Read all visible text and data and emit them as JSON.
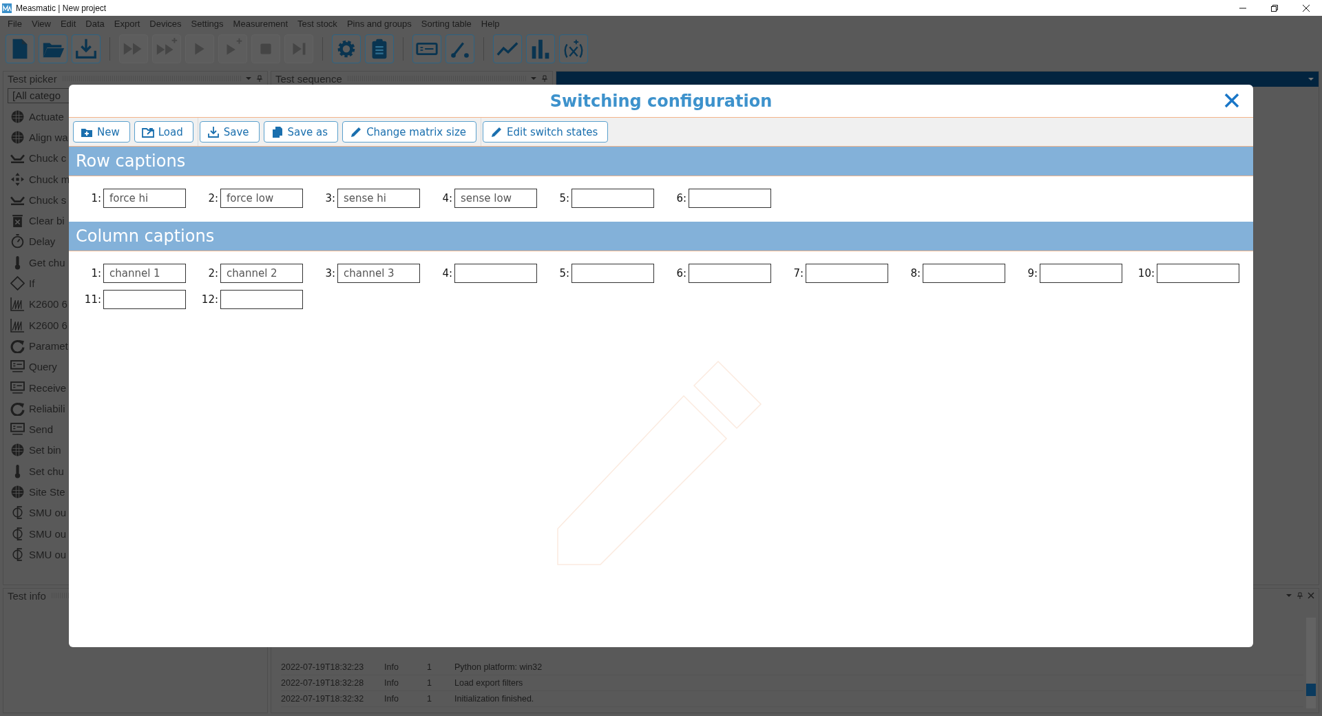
{
  "window": {
    "title": "Measmatic | New project"
  },
  "menu": [
    "File",
    "View",
    "Edit",
    "Data",
    "Export",
    "Devices",
    "Settings",
    "Measurement",
    "Test stock",
    "Pins and groups",
    "Sorting table",
    "Help"
  ],
  "toolbar": [
    [
      {
        "kind": "new-file",
        "disabled": false
      },
      {
        "kind": "folder",
        "disabled": false
      },
      {
        "kind": "download",
        "disabled": false
      }
    ],
    [
      {
        "kind": "fast-forward",
        "disabled": true
      },
      {
        "kind": "fast-forward-plus",
        "disabled": true
      },
      {
        "kind": "play",
        "disabled": true
      },
      {
        "kind": "play-plus",
        "disabled": true
      },
      {
        "kind": "stop",
        "disabled": true
      },
      {
        "kind": "skip",
        "disabled": true
      }
    ],
    [
      {
        "kind": "gear",
        "disabled": false
      },
      {
        "kind": "clipboard",
        "disabled": false
      }
    ],
    [
      {
        "kind": "device",
        "disabled": false
      },
      {
        "kind": "switch",
        "disabled": false
      }
    ],
    [
      {
        "kind": "line-chart",
        "disabled": false
      },
      {
        "kind": "bar-chart",
        "disabled": false
      },
      {
        "kind": "function",
        "disabled": false
      }
    ]
  ],
  "test_picker": {
    "title": "Test picker",
    "filter": "[All catego",
    "items": [
      {
        "label": "Actuate",
        "kind": "wafer"
      },
      {
        "label": "Align wa",
        "kind": "wafer"
      },
      {
        "label": "Chuck c",
        "kind": "chuck"
      },
      {
        "label": "Chuck m",
        "kind": "move"
      },
      {
        "label": "Chuck s",
        "kind": "chuck"
      },
      {
        "label": "Clear bi",
        "kind": "bin"
      },
      {
        "label": "Delay",
        "kind": "timer"
      },
      {
        "label": "Get chu",
        "kind": "thermo"
      },
      {
        "label": "If",
        "kind": "if"
      },
      {
        "label": "K2600 6",
        "kind": "chart"
      },
      {
        "label": "K2600 6",
        "kind": "chart"
      },
      {
        "label": "Paramet",
        "kind": "refresh"
      },
      {
        "label": "Query",
        "kind": "terminal"
      },
      {
        "label": "Receive",
        "kind": "terminal"
      },
      {
        "label": "Reliabili",
        "kind": "refresh"
      },
      {
        "label": "Send",
        "kind": "terminal"
      },
      {
        "label": "Set bin",
        "kind": "wafer"
      },
      {
        "label": "Set chu",
        "kind": "thermo"
      },
      {
        "label": "Site Ste",
        "kind": "wafer"
      },
      {
        "label": "SMU ou",
        "kind": "smu"
      },
      {
        "label": "SMU ou",
        "kind": "smu"
      },
      {
        "label": "SMU ou",
        "kind": "smu"
      }
    ]
  },
  "test_sequence": {
    "title": "Test sequence"
  },
  "test_info": {
    "title": "Test info"
  },
  "log": [
    {
      "time": "2022-07-19T18:32:23",
      "level": "Info",
      "code": "1",
      "message": "Python platform: win32"
    },
    {
      "time": "2022-07-19T18:32:28",
      "level": "Info",
      "code": "1",
      "message": "Load export filters"
    },
    {
      "time": "2022-07-19T18:32:32",
      "level": "Info",
      "code": "1",
      "message": "Initialization finished."
    }
  ],
  "dialog": {
    "title": "Switching configuration",
    "buttons": [
      [
        {
          "label": "New",
          "kind": "folder-plus"
        },
        {
          "label": "Load",
          "kind": "load"
        }
      ],
      [
        {
          "label": "Save",
          "kind": "download"
        },
        {
          "label": "Save as",
          "kind": "copy"
        },
        {
          "label": "Change matrix size",
          "kind": "pencil"
        }
      ],
      [
        {
          "label": "Edit switch states",
          "kind": "pencil"
        }
      ]
    ],
    "sections": [
      {
        "title": "Row captions",
        "fields": [
          {
            "label": "1:",
            "value": "force hi"
          },
          {
            "label": "2:",
            "value": "force low"
          },
          {
            "label": "3:",
            "value": "sense hi"
          },
          {
            "label": "4:",
            "value": "sense low"
          },
          {
            "label": "5:"
          },
          {
            "label": "6:"
          }
        ]
      },
      {
        "title": "Column captions",
        "fields": [
          {
            "label": "1:",
            "value": "channel 1"
          },
          {
            "label": "2:",
            "value": "channel 2"
          },
          {
            "label": "3:",
            "value": "channel 3"
          },
          {
            "label": "4:"
          },
          {
            "label": "5:"
          },
          {
            "label": "6:"
          },
          {
            "label": "7:"
          },
          {
            "label": "8:"
          },
          {
            "label": "9:"
          },
          {
            "label": "10:"
          },
          {
            "label": "11:"
          },
          {
            "label": "12:"
          }
        ]
      }
    ]
  }
}
